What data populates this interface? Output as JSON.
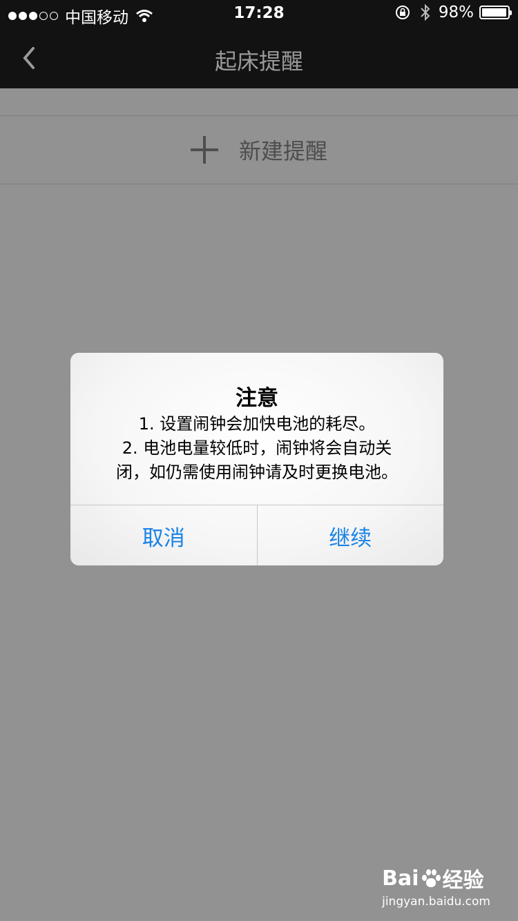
{
  "status_bar": {
    "signal_dots": [
      true,
      true,
      true,
      false,
      false
    ],
    "carrier": "中国移动",
    "time": "17:28",
    "battery": "98%",
    "battery_level": 0.98
  },
  "nav": {
    "title": "起床提醒",
    "back_icon": "chevron-left-icon"
  },
  "list": {
    "new_reminder_label": "新建提醒",
    "add_icon": "plus-icon"
  },
  "dialog": {
    "title": "注意",
    "lines": [
      "1. 设置闹钟会加快电池的耗尽。",
      " 2. 电池电量较低时，闹钟将会自动关",
      "闭，如仍需使用闹钟请及时更换电池。"
    ],
    "cancel_label": "取消",
    "continue_label": "继续"
  },
  "watermark": {
    "brand_left": "Bai",
    "brand_right": "经验",
    "url": "jingyan.baidu.com"
  },
  "colors": {
    "nav_bg": "#121212",
    "page_bg": "#929292",
    "button_blue": "#1a83e6"
  }
}
